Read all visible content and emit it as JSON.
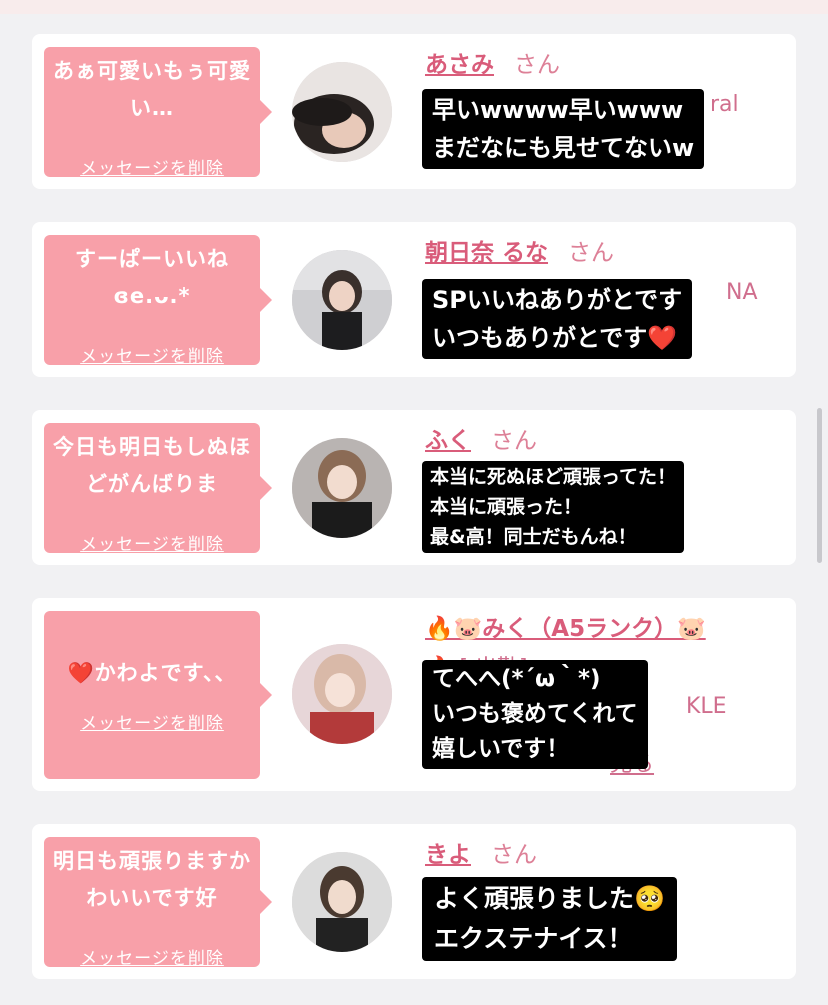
{
  "cards": [
    {
      "message": "あぁ可愛いもぅ可愛い…",
      "delete_label": "メッセージを削除",
      "name": "あさみ",
      "honorific": "さん",
      "under_text": "ral",
      "reply_lines": [
        "早いwwww早いwww",
        "まだなにも見せてないw"
      ]
    },
    {
      "message": "すーぱーいいね\nɞe.ᴗ.*",
      "delete_label": "メッセージを削除",
      "name": "朝日奈 るな",
      "honorific": "さん",
      "under_text": "NA",
      "reply_lines": [
        "SPいいねありがとです",
        "いつもありがとです❤️"
      ]
    },
    {
      "message": "今日も明日もしぬほどがんばりま",
      "delete_label": "メッセージを削除",
      "name": "ふく",
      "honorific": "さん",
      "under_text": "",
      "reply_lines": [
        "本当に死ぬほど頑張ってた！",
        "本当に頑張った！",
        "最&高！同士だもんね！"
      ]
    },
    {
      "message": "❤️かわよです、、",
      "delete_label": "メッセージを削除",
      "name": "🔥🐷みく（A5ランク）🐷",
      "honorific": "",
      "under_text_1": "🔥 [  出勤]",
      "under_text_2": "KLE",
      "under_text_3": "見る",
      "reply_lines": [
        "てへへ(*´ω｀*)",
        "いつも褒めてくれて",
        "嬉しいです！"
      ]
    },
    {
      "message": "明日も頑張りますかわいいです好",
      "delete_label": "メッセージを削除",
      "name": "きよ",
      "honorific": "さん",
      "under_text": "",
      "reply_lines": [
        "よく頑張りました🥺",
        "エクステナイス！"
      ]
    }
  ]
}
